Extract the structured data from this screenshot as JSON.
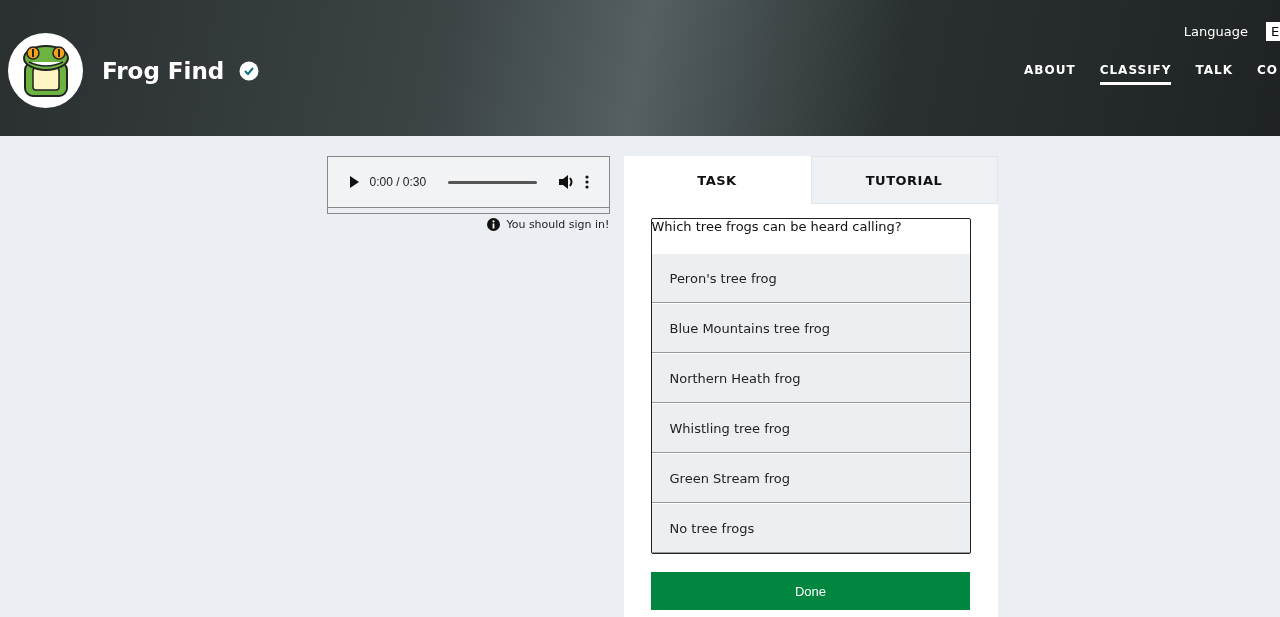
{
  "header": {
    "title": "Frog Find",
    "language": {
      "label": "Language",
      "value": "E"
    },
    "nav": [
      {
        "label": "ABOUT",
        "selected": false
      },
      {
        "label": "CLASSIFY",
        "selected": true
      },
      {
        "label": "TALK",
        "selected": false
      },
      {
        "label": "CO",
        "selected": false
      }
    ]
  },
  "audio": {
    "time": "0:00 / 0:30",
    "note": "You should sign in!"
  },
  "tabs": [
    {
      "label": "TASK",
      "selected": true
    },
    {
      "label": "TUTORIAL",
      "selected": false
    }
  ],
  "question": "Which tree frogs can be heard calling?",
  "options": [
    {
      "label": "Peron's tree frog",
      "selected": false
    },
    {
      "label": "Blue Mountains tree frog",
      "selected": false
    },
    {
      "label": "Northern Heath frog",
      "selected": false
    },
    {
      "label": "Whistling tree frog",
      "selected": false
    },
    {
      "label": "Green Stream frog",
      "selected": false
    },
    {
      "label": "No tree frogs",
      "selected": false
    }
  ],
  "done_button": "Done"
}
